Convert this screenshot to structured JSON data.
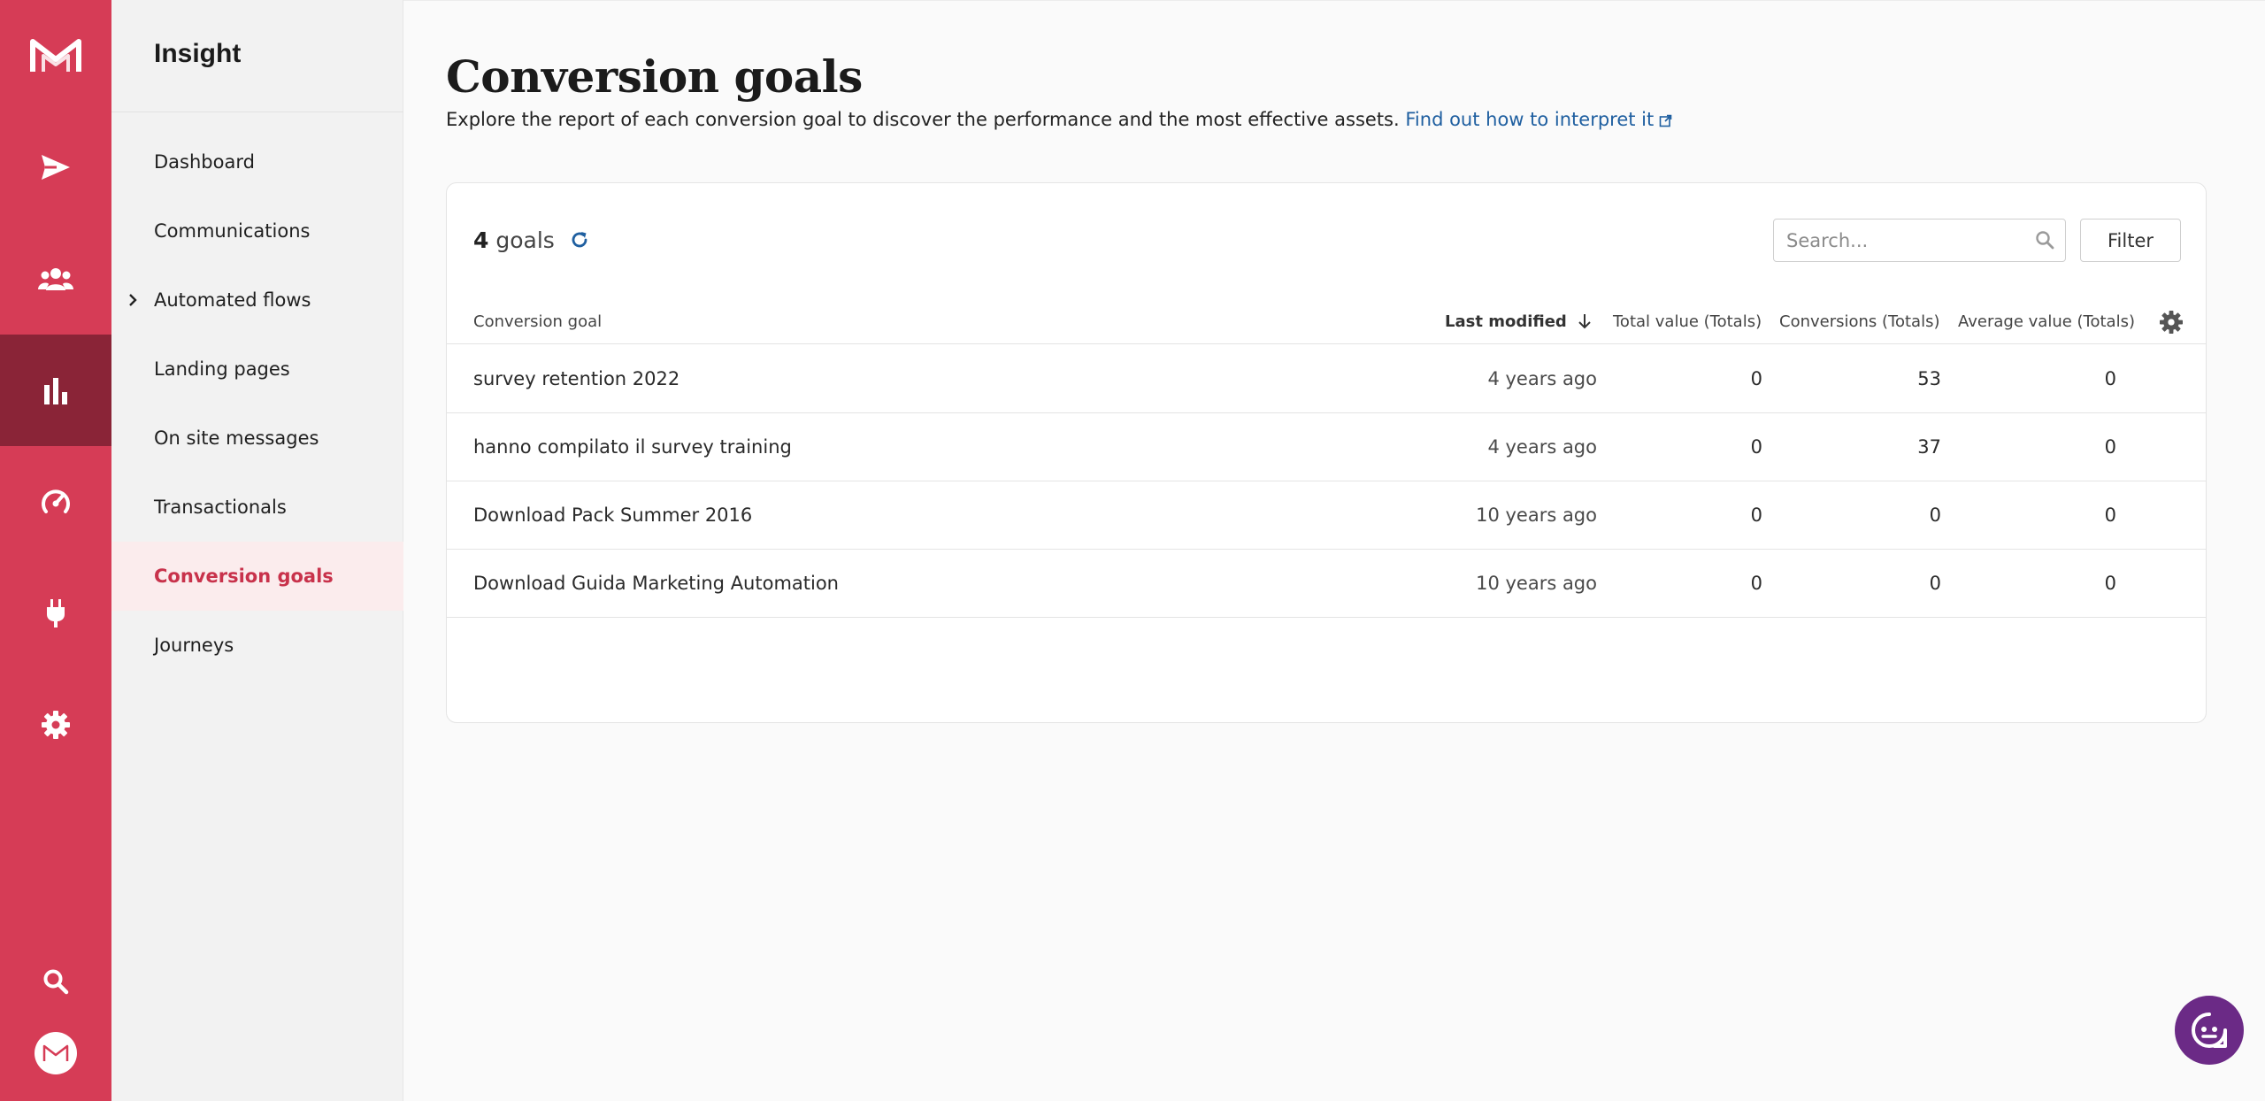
{
  "brand": {
    "accent": "#d63c56",
    "rail_active": "#8a2437",
    "link": "#1f5fa0",
    "chat_bg": "#6b2a86"
  },
  "rail": {
    "items": [
      {
        "icon": "paper-plane-icon"
      },
      {
        "icon": "users-icon"
      },
      {
        "icon": "bar-chart-icon",
        "active": true
      },
      {
        "icon": "gauge-icon"
      },
      {
        "icon": "plug-icon"
      },
      {
        "icon": "gear-icon"
      }
    ],
    "bottom": [
      {
        "icon": "search-icon"
      },
      {
        "icon": "avatar"
      }
    ]
  },
  "sidebar": {
    "title": "Insight",
    "items": [
      {
        "label": "Dashboard"
      },
      {
        "label": "Communications"
      },
      {
        "label": "Automated flows",
        "expandable": true
      },
      {
        "label": "Landing pages"
      },
      {
        "label": "On site messages"
      },
      {
        "label": "Transactionals"
      },
      {
        "label": "Conversion goals",
        "active": true
      },
      {
        "label": "Journeys"
      }
    ]
  },
  "main": {
    "title": "Conversion goals",
    "description": "Explore the report of each conversion goal to discover the performance and the most effective assets.",
    "link_text": "Find out how to interpret it"
  },
  "table": {
    "count": "4",
    "count_label": "goals",
    "search_placeholder": "Search...",
    "filter_label": "Filter",
    "columns": {
      "goal": "Conversion goal",
      "last_modified": "Last modified",
      "total_value": "Total value (Totals)",
      "conversions": "Conversions (Totals)",
      "average_value": "Average value (Totals)"
    },
    "rows": [
      {
        "name": "survey retention 2022",
        "last_modified": "4 years ago",
        "total_value": "0",
        "conversions": "53",
        "average_value": "0"
      },
      {
        "name": "hanno compilato il survey training",
        "last_modified": "4 years ago",
        "total_value": "0",
        "conversions": "37",
        "average_value": "0"
      },
      {
        "name": "Download Pack Summer 2016",
        "last_modified": "10 years ago",
        "total_value": "0",
        "conversions": "0",
        "average_value": "0"
      },
      {
        "name": "Download Guida Marketing Automation",
        "last_modified": "10 years ago",
        "total_value": "0",
        "conversions": "0",
        "average_value": "0"
      }
    ]
  }
}
